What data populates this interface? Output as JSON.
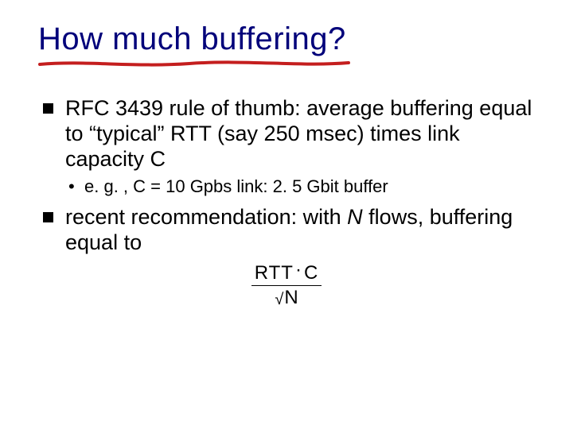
{
  "title": "How much buffering?",
  "bullets": {
    "b1": "RFC 3439 rule of thumb: average buffering equal to “typical” RTT (say 250 msec) times link capacity C",
    "b1_sub": "e. g. , C = 10 Gpbs link: 2. 5 Gbit buffer",
    "b2_pre": "recent recommendation: with ",
    "b2_N": "N",
    "b2_post": " flows, buffering equal to"
  },
  "formula": {
    "numer_left": "RTT",
    "numer_dot": "·",
    "numer_right": "C",
    "denom_surd": "√",
    "denom_rad": "N"
  }
}
